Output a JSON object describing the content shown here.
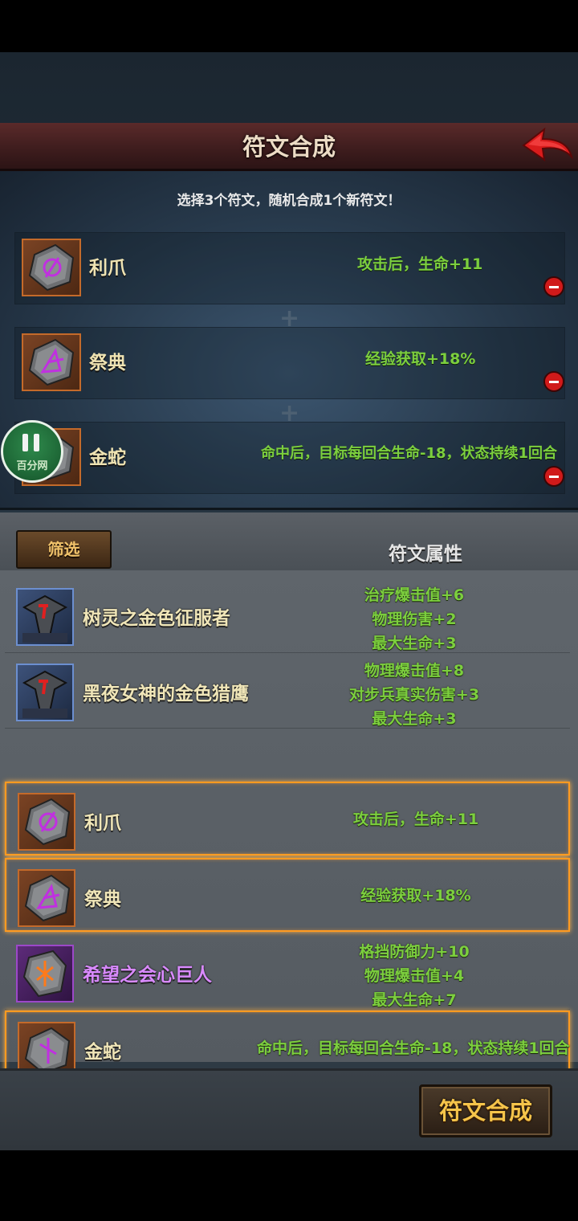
{
  "header": {
    "title": "符文合成"
  },
  "selection": {
    "instruction": "选择3个符文，随机合成1个新符文！",
    "slots": [
      {
        "name": "利爪",
        "effect": "攻击后，生命+11"
      },
      {
        "name": "祭典",
        "effect": "经验获取+18%"
      },
      {
        "name": "金蛇",
        "effect": "命中后，目标每回合生命-18，状态持续1回合"
      }
    ]
  },
  "watermark": {
    "text": "百分网"
  },
  "filter": {
    "button_label": "筛选",
    "column_header": "符文属性"
  },
  "runes": [
    {
      "name": "树灵之金色征服者",
      "stats": [
        "治疗爆击值+6",
        "物理伤害+2",
        "最大生命+3"
      ],
      "selected": false
    },
    {
      "name": "黑夜女神的金色猎鹰",
      "stats": [
        "物理爆击值+8",
        "对步兵真实伤害+3",
        "最大生命+3"
      ],
      "selected": false
    },
    {
      "name": "利爪",
      "stats": [
        "攻击后，生命+11"
      ],
      "selected": true
    },
    {
      "name": "祭典",
      "stats": [
        "经验获取+18%"
      ],
      "selected": true
    },
    {
      "name": "希望之会心巨人",
      "stats": [
        "格挡防御力+10",
        "物理爆击值+4",
        "最大生命+7"
      ],
      "selected": false
    },
    {
      "name": "金蛇",
      "stats": [
        "命中后，目标每回合生命-18，状态持续1回合"
      ],
      "selected": true
    }
  ],
  "action": {
    "synthesize_label": "符文合成"
  },
  "colors": {
    "effect_green": "#7ccf3e",
    "selection_glow": "#ff9a20",
    "rune_glyph_purple": "#c030e0",
    "header_red": "#3f1d1e"
  },
  "icons": {
    "back": "red-back-arrow-icon",
    "remove": "minus-circle-icon",
    "rune": "rune-stone-icon",
    "helmet": "helmet-icon"
  }
}
